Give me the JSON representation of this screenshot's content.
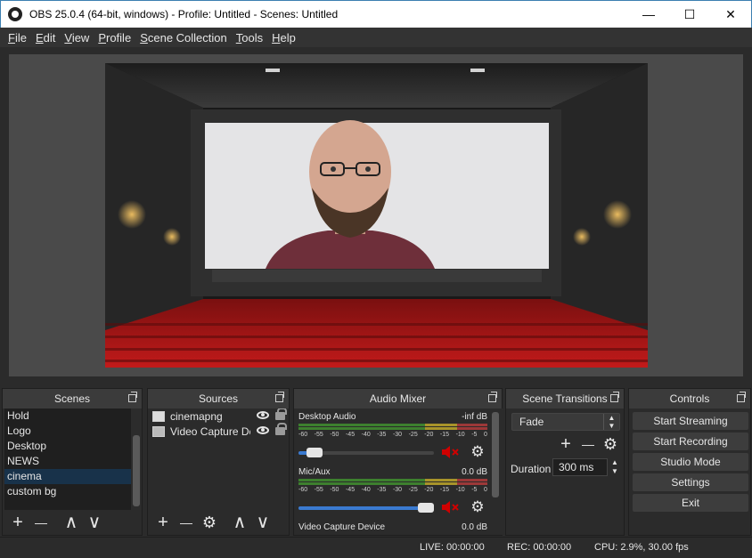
{
  "window": {
    "title": "OBS 25.0.4 (64-bit, windows) - Profile: Untitled - Scenes: Untitled",
    "buttons": {
      "minimize": "—",
      "maximize": "☐",
      "close": "✕"
    }
  },
  "menu": [
    {
      "mnemonic": "F",
      "rest": "ile"
    },
    {
      "mnemonic": "E",
      "rest": "dit"
    },
    {
      "mnemonic": "V",
      "rest": "iew"
    },
    {
      "mnemonic": "P",
      "rest": "rofile"
    },
    {
      "mnemonic": "S",
      "rest": "cene Collection"
    },
    {
      "mnemonic": "T",
      "rest": "ools"
    },
    {
      "mnemonic": "H",
      "rest": "elp"
    }
  ],
  "scenes": {
    "title": "Scenes",
    "items": [
      "Hold",
      "Logo",
      "Desktop",
      "NEWS",
      "cinema",
      "custom bg"
    ],
    "selected": "cinema"
  },
  "sources": {
    "title": "Sources",
    "items": [
      {
        "label": "cinemapng",
        "icon": "image-icon"
      },
      {
        "label": "Video Capture Dev",
        "icon": "camera-icon"
      }
    ]
  },
  "mixer": {
    "title": "Audio Mixer",
    "channels": [
      {
        "name": "Desktop Audio",
        "db": "-inf dB",
        "volume": 0.07
      },
      {
        "name": "Mic/Aux",
        "db": "0.0 dB",
        "volume": 1.0
      },
      {
        "name": "Video Capture Device",
        "db": "0.0 dB",
        "volume": 1.0
      }
    ],
    "scale": [
      "-60",
      "-55",
      "-50",
      "-45",
      "-40",
      "-35",
      "-30",
      "-25",
      "-20",
      "-15",
      "-10",
      "-5",
      "0"
    ]
  },
  "transitions": {
    "title": "Scene Transitions",
    "selected": "Fade",
    "duration_label": "Duration",
    "duration_value": "300 ms"
  },
  "controls": {
    "title": "Controls",
    "buttons": [
      "Start Streaming",
      "Start Recording",
      "Studio Mode",
      "Settings",
      "Exit"
    ]
  },
  "status": {
    "live": "LIVE: 00:00:00",
    "rec": "REC: 00:00:00",
    "cpu": "CPU: 2.9%, 30.00 fps"
  },
  "toolbar_glyphs": {
    "add": "+",
    "remove": "—",
    "up": "∧",
    "down": "∨",
    "settings": "⚙"
  },
  "colors": {
    "accent": "#3a7ad0",
    "selection": "#18324a",
    "mute": "#d00000"
  }
}
